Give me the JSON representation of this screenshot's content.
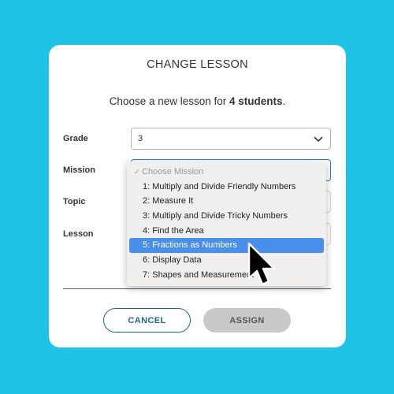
{
  "modal": {
    "title": "CHANGE LESSON",
    "subtitle_prefix": "Choose a new lesson for ",
    "subtitle_bold": "4 students",
    "subtitle_suffix": "."
  },
  "fields": {
    "grade": {
      "label": "Grade",
      "value": "3"
    },
    "mission": {
      "label": "Mission"
    },
    "topic": {
      "label": "Topic"
    },
    "lesson": {
      "label": "Lesson"
    }
  },
  "mission_dropdown": {
    "placeholder": "Choose Mission",
    "options": [
      "1: Multiply and Divide Friendly Numbers",
      "2: Measure It",
      "3: Multiply and Divide Tricky Numbers",
      "4: Find the Area",
      "5: Fractions as Numbers",
      "6: Display Data",
      "7: Shapes and Measurement"
    ],
    "highlighted_index": 4
  },
  "buttons": {
    "cancel": "CANCEL",
    "assign": "ASSIGN"
  },
  "colors": {
    "background": "#1fc3e6",
    "cancel_border": "#1b6a8a",
    "assign_bg": "#c9c9c9",
    "highlight": "#4a8fec"
  }
}
